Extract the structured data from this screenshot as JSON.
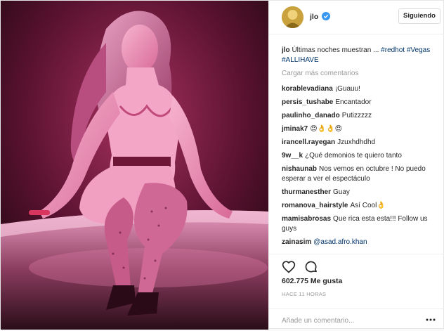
{
  "header": {
    "username": "jlo",
    "follow_label": "Siguiendo"
  },
  "caption": {
    "username": "jlo",
    "text": "Últimas noches muestran ...",
    "tags": "#redhot #Vegas #ALLIHAVE"
  },
  "load_more": "Cargar más comentarios",
  "comments": [
    {
      "user": "korablevadiana",
      "text": "¡Guauu!"
    },
    {
      "user": "persis_tushabe",
      "text": "Encantador"
    },
    {
      "user": "paulinho_danado",
      "text": "Putizzzzz"
    },
    {
      "user": "jminak7",
      "text": "😍👌👌😍"
    },
    {
      "user": "irancell.rayegan",
      "text": "Jzuxhdhdhd"
    },
    {
      "user": "9w__k",
      "text": "¿Qué demonios te quiero tanto"
    },
    {
      "user": "nishaunab",
      "text": "Nos vemos en octubre ! No puedo esperar a ver el espectáculo"
    },
    {
      "user": "thurmanesther",
      "text": "Guay"
    },
    {
      "user": "romanova_hairstyle",
      "text": "Así Cool👌"
    },
    {
      "user": "mamisabrosas",
      "text": "Que rica esta esta!!! Follow us guys"
    },
    {
      "user": "zainasim",
      "text": "@asad.afro.khan"
    }
  ],
  "likes": "602.775 Me gusta",
  "time": "HACE 11 HORAS",
  "add_comment_placeholder": "Añade un comentario...",
  "colors": {
    "accent": "#003569",
    "verified": "#3897f0",
    "muted": "#999999",
    "photo_pink": "#e0609a"
  },
  "icons": [
    "heart-icon",
    "comment-icon",
    "verified-icon",
    "more-options-icon"
  ]
}
